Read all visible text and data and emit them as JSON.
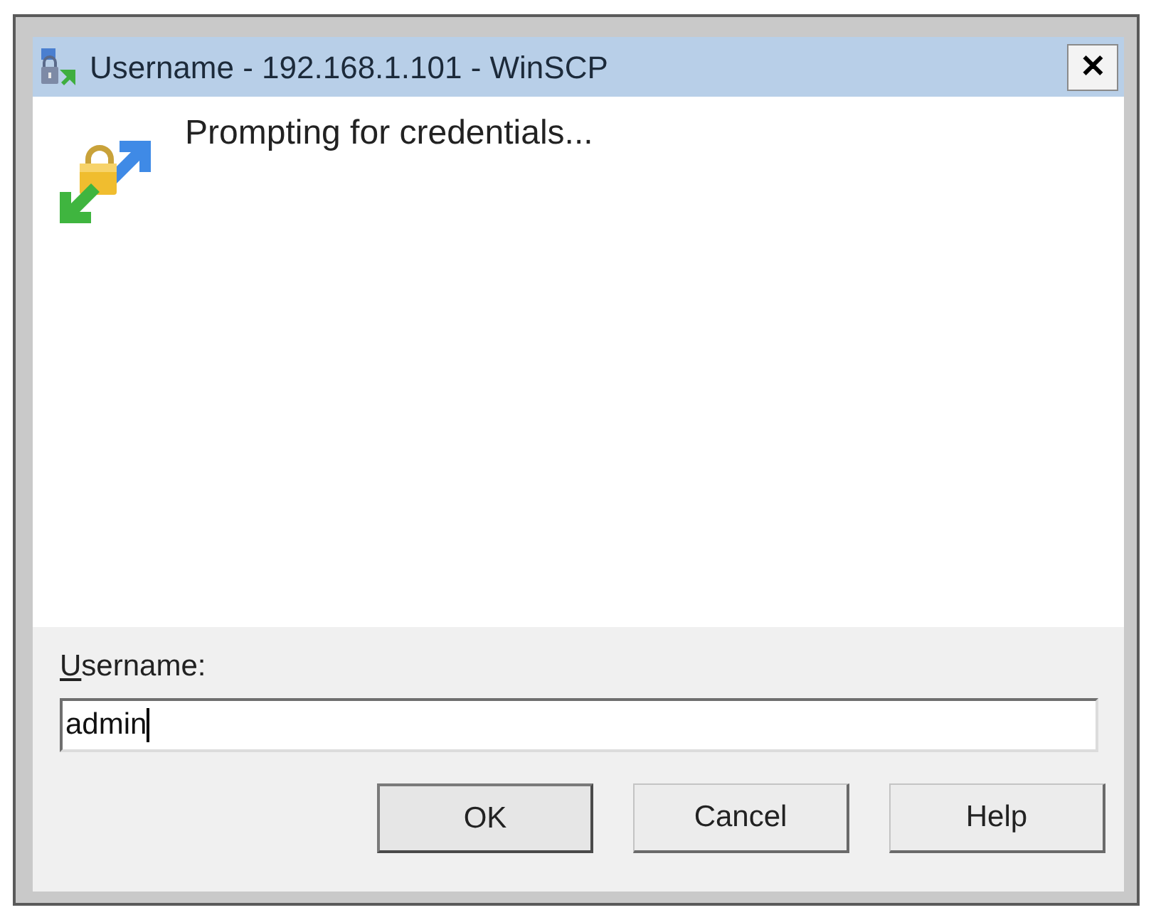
{
  "window": {
    "title": "Username - 192.168.1.101 - WinSCP",
    "close_symbol": "✕"
  },
  "message": "Prompting for credentials...",
  "prompt": {
    "label": "Username:",
    "access_key_underlined": true,
    "value": "admin",
    "focused": true
  },
  "buttons": [
    {
      "label": "OK",
      "default": true
    },
    {
      "label": "Cancel",
      "default": false
    },
    {
      "label": "Help",
      "default": false
    }
  ]
}
